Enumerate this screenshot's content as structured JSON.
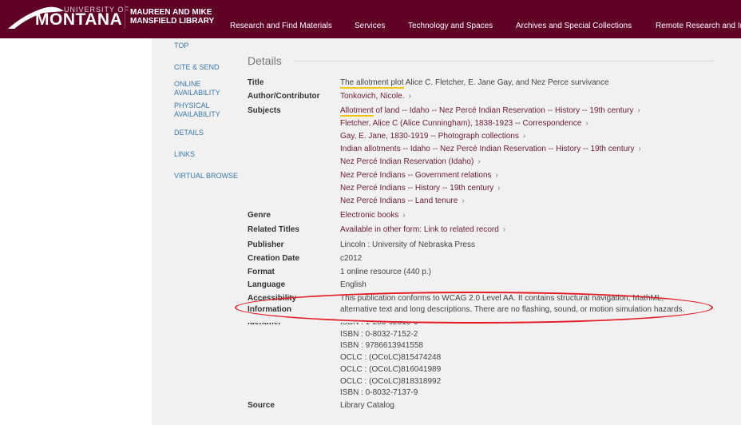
{
  "header": {
    "logo_small": "UNIVERSITY OF",
    "logo_big": "MONTANA",
    "library": [
      "MAUREEN AND MIKE",
      "MANSFIELD LIBRARY"
    ],
    "nav": [
      "Research and Find Materials",
      "Services",
      "Technology and Spaces",
      "Archives and Special Collections",
      "Remote Research and In"
    ]
  },
  "side_nav": [
    "TOP",
    "CITE & SEND",
    "ONLINE AVAILABILITY",
    "PHYSICAL AVAILABILITY",
    "DETAILS",
    "LINKS",
    "VIRTUAL BROWSE"
  ],
  "details": {
    "heading": "Details",
    "title_label": "Title",
    "title_link": "The allotment plot",
    "title_rest": " Alice C. Fletcher, E. Jane Gay, and Nez Perce survivance",
    "author_label": "Author/Contributor",
    "author": "Tonkovich, Nicole.",
    "subjects_label": "Subjects",
    "subjects": [
      "Allotment of land -- Idaho -- Nez Percé Indian Reservation -- History -- 19th century",
      "Fletcher, Alice C (Alice Cunningham), 1838-1923 -- Correspondence",
      "Gay, E. Jane, 1830-1919 -- Photograph collections",
      "Indian allotments -- Idaho -- Nez Percé Indian Reservation -- History -- 19th century",
      "Nez Percé Indian Reservation (Idaho)",
      "Nez Percé Indians -- Government relations",
      "Nez Percé Indians -- History -- 19th century",
      "Nez Percé Indians -- Land tenure"
    ],
    "genre_label": "Genre",
    "genre": "Electronic books",
    "related_label": "Related Titles",
    "related": "Available in other form: Link to related record",
    "publisher_label": "Publisher",
    "publisher": "Lincoln : University of Nebraska Press",
    "date_label": "Creation Date",
    "date": "c2012",
    "format_label": "Format",
    "format": "1 online resource (440 p.)",
    "language_label": "Language",
    "language": "English",
    "access_label": [
      "Accessibility",
      "Information"
    ],
    "access": [
      "This publication conforms to WCAG 2.0 Level AA. It contains structural navigation, MathML,",
      "alternative text and long descriptions. There are no flashing, sound, or motion simulation hazards."
    ],
    "identifier_label": "Identifier",
    "identifiers": [
      "ISBN : 1-283-62510-6",
      "ISBN : 0-8032-7152-2",
      "ISBN : 9786613941558",
      "OCLC : (OCoLC)815474248",
      "OCLC : (OCoLC)816041989",
      "OCLC : (OCoLC)818318992",
      "ISBN : 0-8032-7137-9"
    ],
    "source_label": "Source",
    "source": "Library Catalog"
  },
  "chevron": "›",
  "colors": {
    "brand": "#5f0124",
    "link": "#6b1a3c",
    "annotation": "#e31b23"
  }
}
